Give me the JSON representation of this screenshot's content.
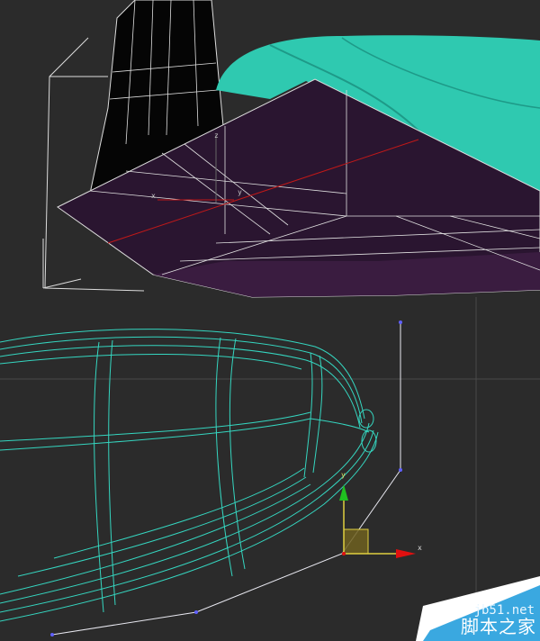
{
  "viewport": {
    "background": "#2b2b2b",
    "top_object_axes": {
      "x": "x",
      "y": "y",
      "z": "z"
    },
    "gizmo_axes": {
      "x": "x",
      "y": "y"
    },
    "colors": {
      "wire_teal": "#35d6c0",
      "solid_teal": "#2fc9b0",
      "plane": "#2a1530",
      "gizmo_x": "#e01010",
      "gizmo_y": "#20c020",
      "gizmo_plane": "#e0d040",
      "spline": "#e8e8f0"
    }
  },
  "watermark": {
    "url": "jb51.net",
    "name": "脚本之家",
    "color": "#3aa8e0"
  }
}
